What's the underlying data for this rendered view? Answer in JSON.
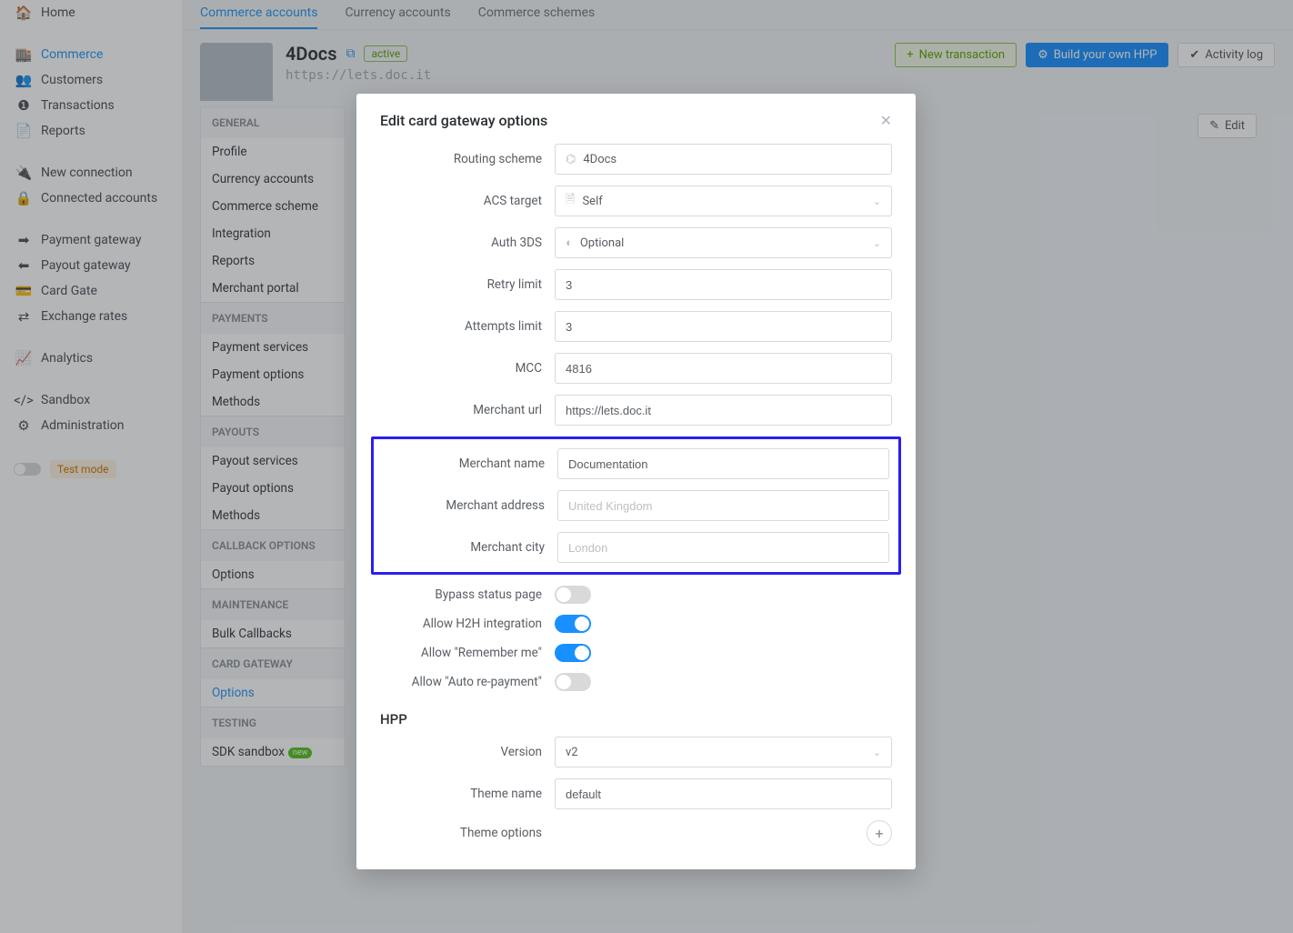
{
  "sidebar": {
    "items": [
      {
        "label": "Home",
        "icon": "home"
      },
      {
        "label": "Commerce",
        "icon": "store",
        "active": true
      },
      {
        "label": "Customers",
        "icon": "users"
      },
      {
        "label": "Transactions",
        "icon": "dollar"
      },
      {
        "label": "Reports",
        "icon": "file"
      },
      {
        "label": "New connection",
        "icon": "plug"
      },
      {
        "label": "Connected accounts",
        "icon": "lock"
      },
      {
        "label": "Payment gateway",
        "icon": "signin"
      },
      {
        "label": "Payout gateway",
        "icon": "signout"
      },
      {
        "label": "Card Gate",
        "icon": "card"
      },
      {
        "label": "Exchange rates",
        "icon": "exchange"
      },
      {
        "label": "Analytics",
        "icon": "chart"
      },
      {
        "label": "Sandbox",
        "icon": "code"
      },
      {
        "label": "Administration",
        "icon": "gear"
      }
    ],
    "testmode": "Test mode"
  },
  "tabs": {
    "commerce_accounts": "Commerce accounts",
    "currency_accounts": "Currency accounts",
    "commerce_schemes": "Commerce schemes"
  },
  "header": {
    "title": "4Docs",
    "status": "active",
    "url": "https://lets.doc.it",
    "new_tx": "New transaction",
    "build_hpp": "Build your own HPP",
    "activity_log": "Activity log",
    "edit": "Edit"
  },
  "inner_menu": {
    "general": "GENERAL",
    "profile": "Profile",
    "currency_accounts": "Currency accounts",
    "commerce_scheme": "Commerce scheme",
    "integration": "Integration",
    "reports": "Reports",
    "merchant_portal": "Merchant portal",
    "payments": "PAYMENTS",
    "payment_services": "Payment services",
    "payment_options": "Payment options",
    "methods1": "Methods",
    "payouts": "PAYOUTS",
    "payout_services": "Payout services",
    "payout_options": "Payout options",
    "methods2": "Methods",
    "callback": "CALLBACK OPTIONS",
    "options_cb": "Options",
    "maintenance": "MAINTENANCE",
    "bulk": "Bulk Callbacks",
    "cardgw": "CARD GATEWAY",
    "options_cg": "Options",
    "testing": "TESTING",
    "sdk": "SDK sandbox",
    "new_pill": "new"
  },
  "modal": {
    "title": "Edit card gateway options",
    "routing_scheme_label": "Routing scheme",
    "routing_scheme_value": "4Docs",
    "acs_target_label": "ACS target",
    "acs_target_value": "Self",
    "auth3ds_label": "Auth 3DS",
    "auth3ds_value": "Optional",
    "retry_label": "Retry limit",
    "retry_value": "3",
    "attempts_label": "Attempts limit",
    "attempts_value": "3",
    "mcc_label": "MCC",
    "mcc_value": "4816",
    "murl_label": "Merchant url",
    "murl_value": "https://lets.doc.it",
    "mname_label": "Merchant name",
    "mname_value": "Documentation",
    "maddr_label": "Merchant address",
    "maddr_placeholder": "United Kingdom",
    "mcity_label": "Merchant city",
    "mcity_placeholder": "London",
    "bypass_label": "Bypass status page",
    "h2h_label": "Allow H2H integration",
    "remember_label": "Allow \"Remember me\"",
    "autorepay_label": "Allow \"Auto re-payment\"",
    "hpp_title": "HPP",
    "version_label": "Version",
    "version_value": "v2",
    "theme_label": "Theme name",
    "theme_value": "default",
    "theme_opts_label": "Theme options"
  }
}
